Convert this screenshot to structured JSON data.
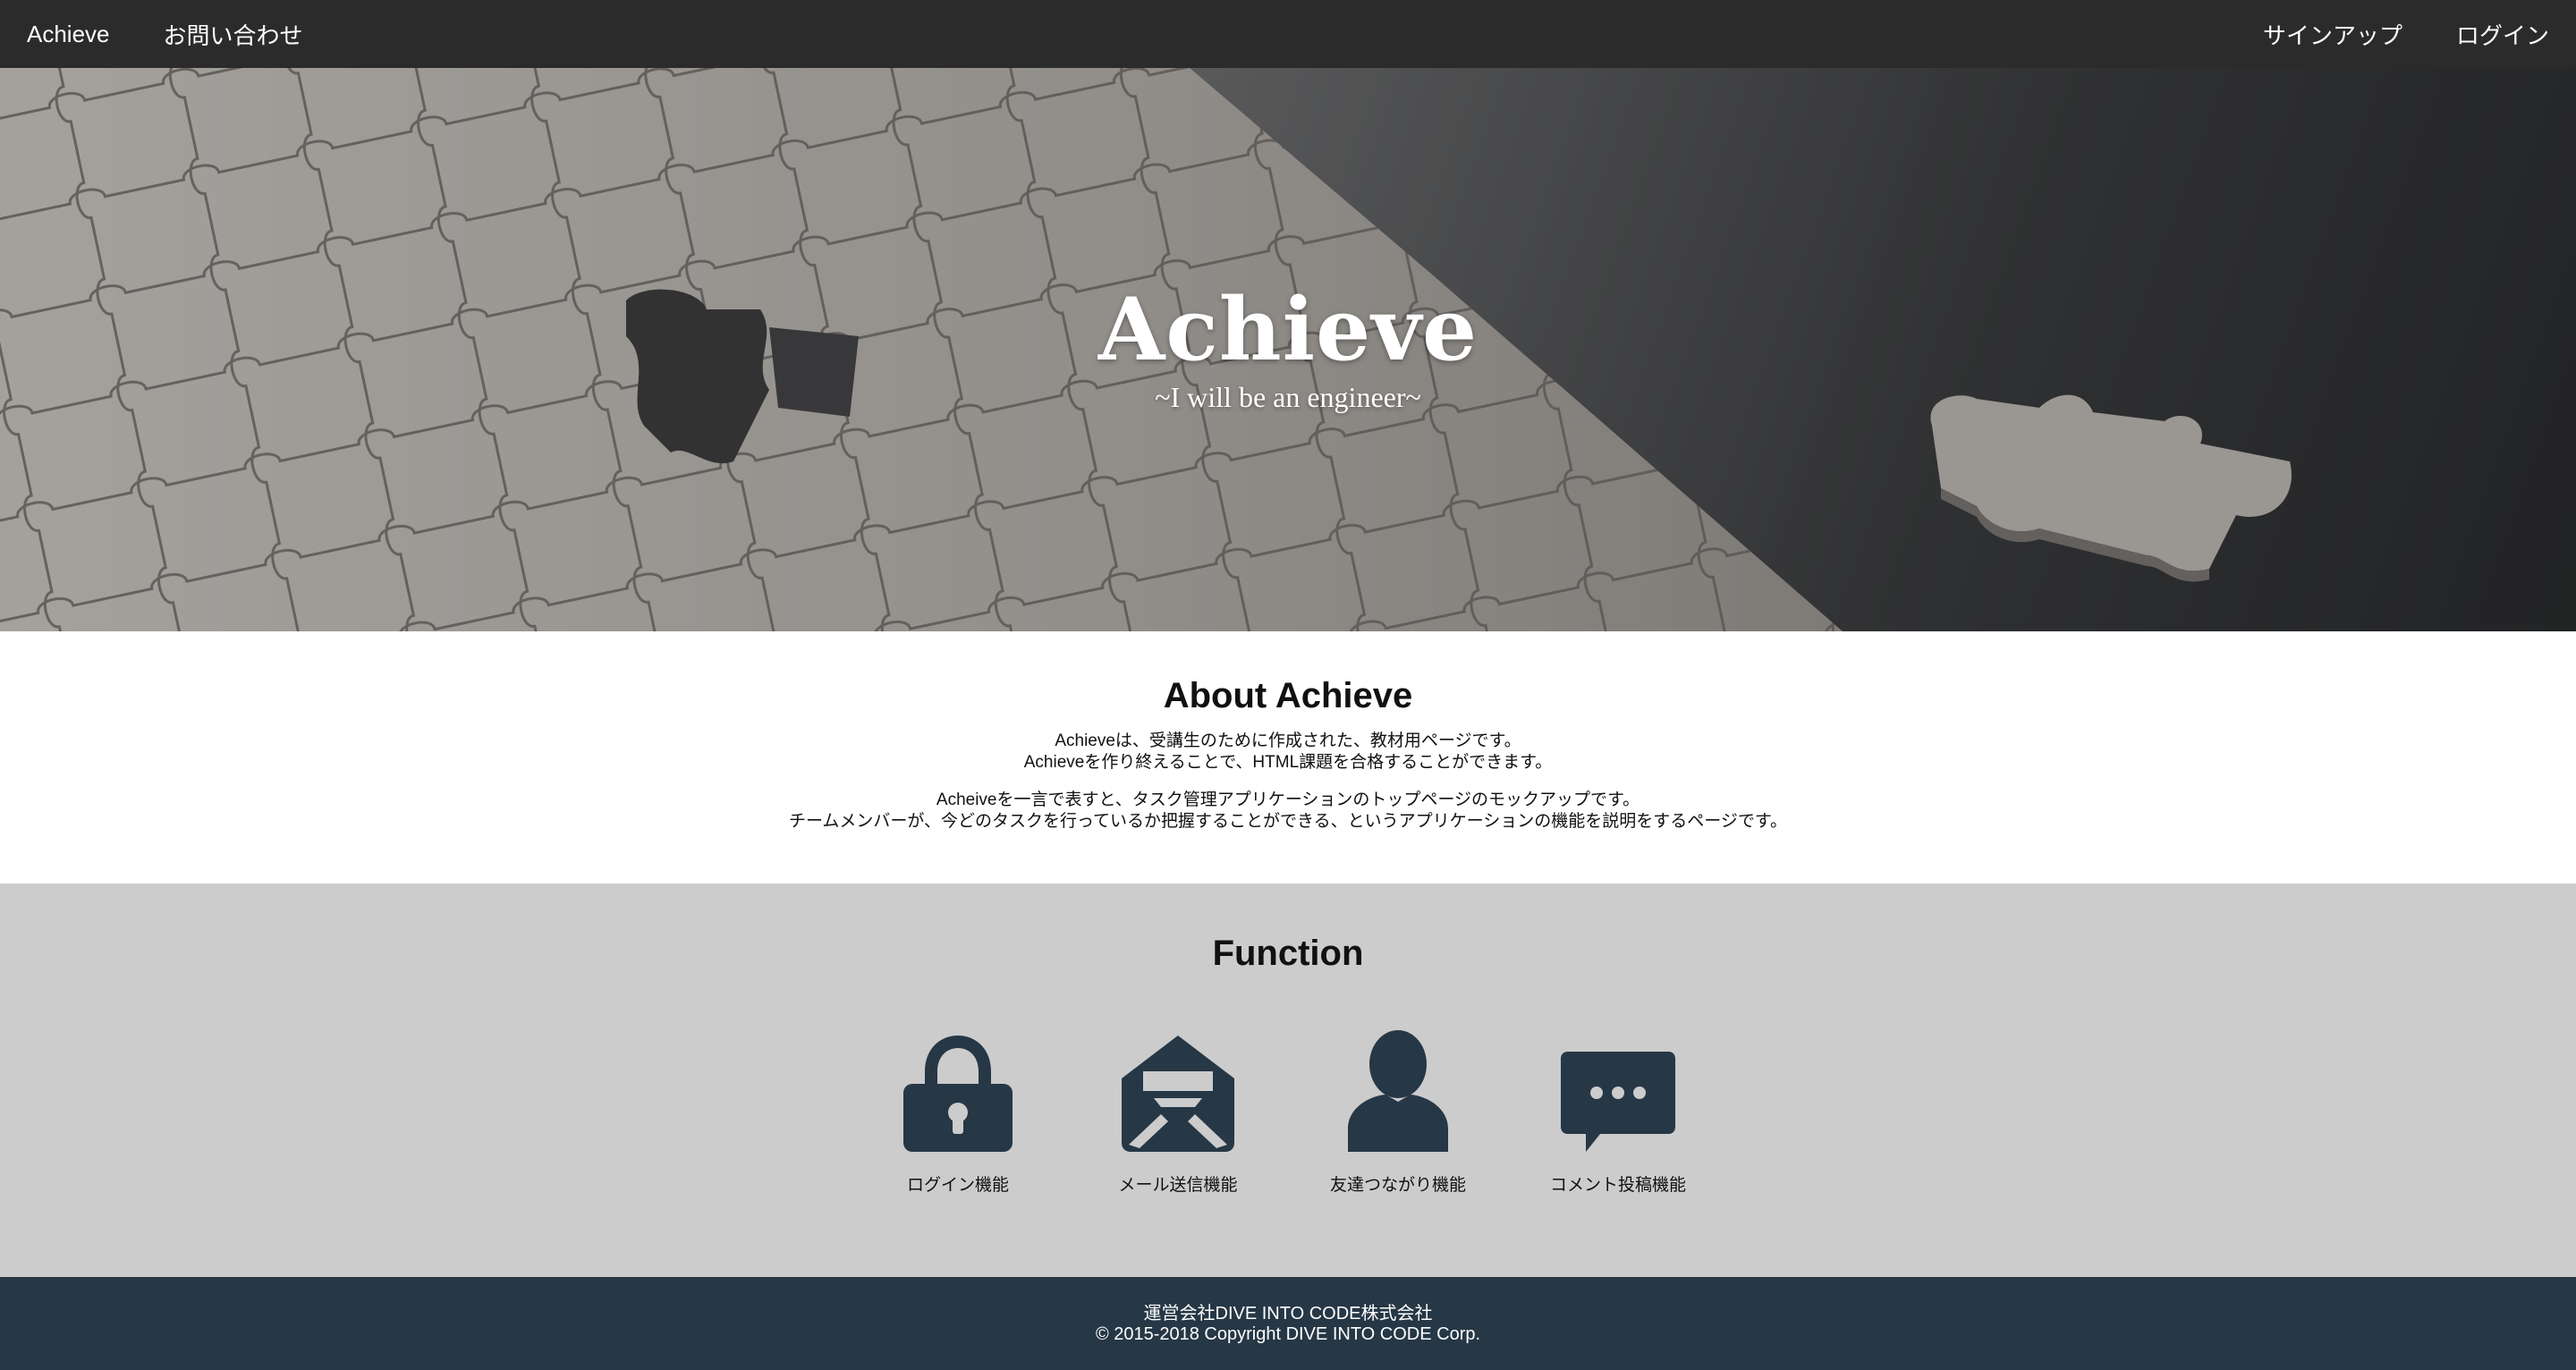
{
  "navbar": {
    "brand": "Achieve",
    "contact": "お問い合わせ",
    "signup": "サインアップ",
    "login": "ログイン"
  },
  "hero": {
    "title": "Achieve",
    "subtitle": "~I will be an engineer~"
  },
  "about": {
    "heading": "About Achieve",
    "paragraph1_line1": "Achieveは、受講生のために作成された、教材用ページです。",
    "paragraph1_line2": "Achieveを作り終えることで、HTML課題を合格することができます。",
    "paragraph2_line1": "Acheiveを一言で表すと、タスク管理アプリケーションのトップページのモックアップです。",
    "paragraph2_line2": "チームメンバーが、今どのタスクを行っているか把握することができる、というアプリケーションの機能を説明をするページです。"
  },
  "function": {
    "heading": "Function",
    "features": [
      {
        "icon": "lock-icon",
        "label": "ログイン機能"
      },
      {
        "icon": "mail-icon",
        "label": "メール送信機能"
      },
      {
        "icon": "user-icon",
        "label": "友達つながり機能"
      },
      {
        "icon": "comment-icon",
        "label": "コメント投稿機能"
      }
    ],
    "icon_color": "#263746"
  },
  "footer": {
    "company": "運営会社DIVE INTO CODE株式会社",
    "copyright": "© 2015-2018 Copyright DIVE INTO CODE Corp."
  },
  "colors": {
    "navbar_bg": "#2b2b2b",
    "function_bg": "#cccccc",
    "footer_bg": "#263746"
  }
}
